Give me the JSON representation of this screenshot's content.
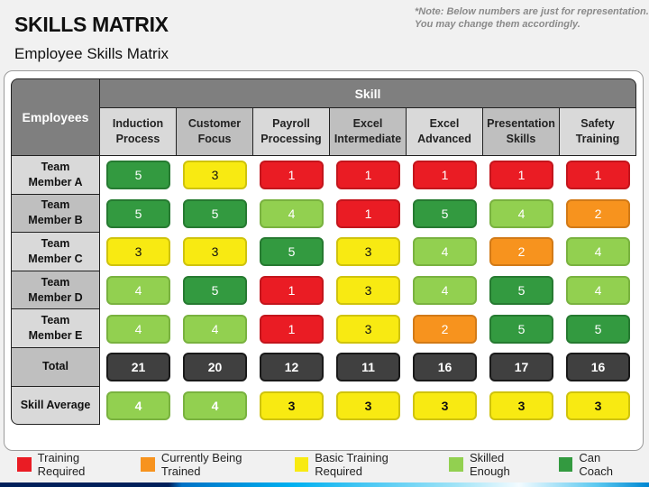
{
  "header": {
    "title": "SKILLS MATRIX",
    "subtitle": "Employee Skills Matrix",
    "note_line1": "*Note: Below numbers are just for representation.",
    "note_line2": "You may change them accordingly."
  },
  "matrix": {
    "employees_header": "Employees",
    "skill_header": "Skill",
    "skills": [
      {
        "line1": "Induction",
        "line2": "Process"
      },
      {
        "line1": "Customer",
        "line2": "Focus"
      },
      {
        "line1": "Payroll",
        "line2": "Processing"
      },
      {
        "line1": "Excel",
        "line2": "Intermediate"
      },
      {
        "line1": "Excel",
        "line2": "Advanced"
      },
      {
        "line1": "Presentation",
        "line2": "Skills"
      },
      {
        "line1": "Safety",
        "line2": "Training"
      }
    ],
    "members": [
      {
        "line1": "Team",
        "line2": "Member A",
        "scores": [
          5,
          3,
          1,
          1,
          1,
          1,
          1
        ]
      },
      {
        "line1": "Team",
        "line2": "Member B",
        "scores": [
          5,
          5,
          4,
          1,
          5,
          4,
          2
        ]
      },
      {
        "line1": "Team",
        "line2": "Member C",
        "scores": [
          3,
          3,
          5,
          3,
          4,
          2,
          4
        ]
      },
      {
        "line1": "Team",
        "line2": "Member D",
        "scores": [
          4,
          5,
          1,
          3,
          4,
          5,
          4
        ]
      },
      {
        "line1": "Team",
        "line2": "Member E",
        "scores": [
          4,
          4,
          1,
          3,
          2,
          5,
          5
        ]
      }
    ],
    "total_label": "Total",
    "totals": [
      21,
      20,
      12,
      11,
      16,
      17,
      16
    ],
    "average_label": "Skill Average",
    "averages": [
      4,
      4,
      3,
      3,
      3,
      3,
      3
    ]
  },
  "legend": [
    {
      "level": 1,
      "label": "Training Required",
      "color": "#ea1c24"
    },
    {
      "level": 2,
      "label": "Currently Being Trained",
      "color": "#f7931e"
    },
    {
      "level": 3,
      "label": "Basic Training Required",
      "color": "#f8ea12"
    },
    {
      "level": 4,
      "label": "Skilled Enough",
      "color": "#92d050"
    },
    {
      "level": 5,
      "label": "Can Coach",
      "color": "#339a40"
    }
  ]
}
